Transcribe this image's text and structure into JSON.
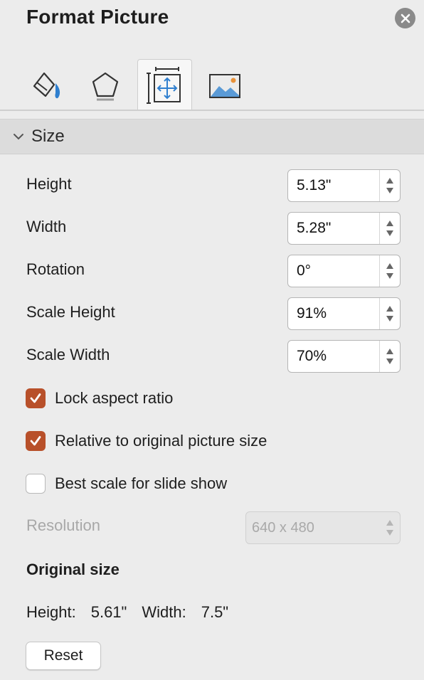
{
  "panel": {
    "title": "Format Picture",
    "close_icon": "close-icon"
  },
  "tabs": [
    {
      "name": "fill-line",
      "icon": "paint-bucket-icon",
      "active": false
    },
    {
      "name": "effects",
      "icon": "pentagon-icon",
      "active": false
    },
    {
      "name": "size-properties",
      "icon": "size-move-icon",
      "active": true
    },
    {
      "name": "picture",
      "icon": "picture-icon",
      "active": false
    }
  ],
  "section": {
    "label": "Size",
    "expanded": true
  },
  "fields": {
    "height": {
      "label": "Height",
      "value": "5.13\""
    },
    "width": {
      "label": "Width",
      "value": "5.28\""
    },
    "rotation": {
      "label": "Rotation",
      "value": "0°"
    },
    "scale_height": {
      "label": "Scale Height",
      "value": "91%"
    },
    "scale_width": {
      "label": "Scale Width",
      "value": "70%"
    }
  },
  "checkboxes": {
    "lock_aspect": {
      "label": "Lock aspect ratio",
      "checked": true
    },
    "relative_original": {
      "label": "Relative to original picture size",
      "checked": true
    },
    "best_scale": {
      "label": "Best scale for slide show",
      "checked": false
    }
  },
  "resolution": {
    "label": "Resolution",
    "value": "640 x 480",
    "disabled": true
  },
  "original_size": {
    "title": "Original size",
    "height_label": "Height:",
    "height_value": "5.61\"",
    "width_label": "Width:",
    "width_value": "7.5\""
  },
  "reset_label": "Reset",
  "colors": {
    "accent": "#b8502a",
    "tab_active_blue": "#3a8dd6",
    "background": "#ececec"
  }
}
